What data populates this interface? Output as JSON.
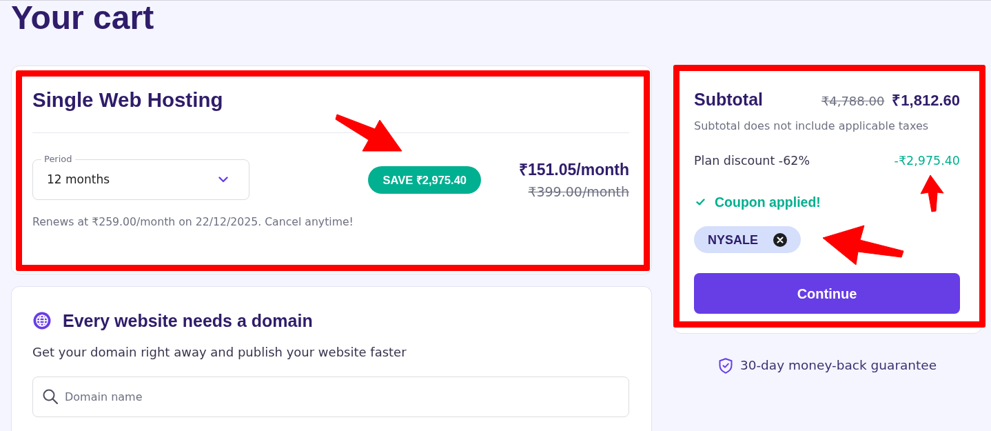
{
  "page": {
    "title": "Your cart"
  },
  "hosting_card": {
    "highlighted": true,
    "title": "Single Web Hosting",
    "period": {
      "label": "Period",
      "value": "12 months"
    },
    "save_badge": {
      "text": "SAVE ₹2,975.40",
      "pointed_at": true
    },
    "price": "₹151.05/month",
    "old_price": "₹399.00/month",
    "renewal_note": "Renews at ₹259.00/month on 22/12/2025. Cancel anytime!"
  },
  "domain_card": {
    "title": "Every website needs a domain",
    "subtitle": "Get your domain right away and publish your website faster",
    "search": {
      "placeholder": "Domain name"
    }
  },
  "summary": {
    "highlighted": true,
    "title": "Subtotal",
    "old_total": "₹4,788.00",
    "total": "₹1,812.60",
    "note": "Subtotal does not include applicable taxes",
    "discount": {
      "label": "Plan discount -62%",
      "amount": "-₹2,975.40",
      "pointed_at": true
    },
    "coupon_status": "Coupon applied!",
    "coupon": {
      "code": "NYSALE",
      "pointed_at": true
    },
    "button": "Continue"
  },
  "guarantee": "30-day money-back guarantee"
}
